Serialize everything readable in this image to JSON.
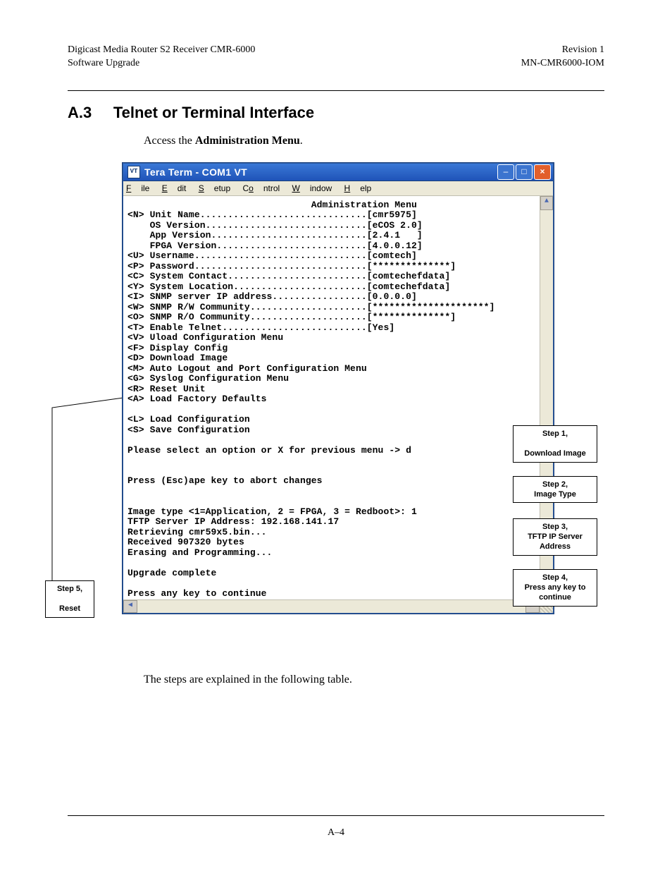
{
  "header": {
    "left1": "Digicast Media Router S2 Receiver CMR-6000",
    "left2": "Software Upgrade",
    "right1": "Revision 1",
    "right2": "MN-CMR6000-IOM"
  },
  "section": {
    "number": "A.3",
    "title": "Telnet or Terminal Interface"
  },
  "intro": {
    "prefix": "Access the ",
    "bold": "Administration Menu",
    "suffix": "."
  },
  "terminal": {
    "window_title": "Tera Term - COM1 VT",
    "menu": {
      "file": "File",
      "edit": "Edit",
      "setup": "Setup",
      "control": "Control",
      "window": "Window",
      "help": "Help"
    },
    "content": "                                 Administration Menu\n<N> Unit Name..............................[cmr5975]\n    OS Version.............................[eCOS 2.0]\n    App Version............................[2.4.1   ]\n    FPGA Version...........................[4.0.0.12]\n<U> Username...............................[comtech]\n<P> Password...............................[**************]\n<C> System Contact.........................[comtechefdata]\n<Y> System Location........................[comtechefdata]\n<I> SNMP server IP address.................[0.0.0.0]\n<W> SNMP R/W Community.....................[*********************]\n<O> SNMP R/O Community.....................[**************]\n<T> Enable Telnet..........................[Yes]\n<V> Uload Configuration Menu\n<F> Display Config\n<D> Download Image\n<M> Auto Logout and Port Configuration Menu\n<G> Syslog Configuration Menu\n<R> Reset Unit\n<A> Load Factory Defaults\n\n<L> Load Configuration\n<S> Save Configuration\n\nPlease select an option or X for previous menu -> d\n\n\nPress (Esc)ape key to abort changes\n\n\nImage type <1=Application, 2 = FPGA, 3 = Redboot>: 1\nTFTP Server IP Address: 192.168.141.17\nRetrieving cmr59x5.bin...\nReceived 907320 bytes\nErasing and Programming...\n\nUpgrade complete\n\nPress any key to continue"
  },
  "callouts": {
    "step1": "Step 1,\n<D>\nDownload Image",
    "step2": "Step 2,\nImage Type",
    "step3": "Step 3,\nTFTP IP Server\nAddress",
    "step4": "Step 4,\nPress any key to\ncontinue",
    "step5": "Step 5,\n<R>\nReset"
  },
  "follow_text": "The steps are explained in the following table.",
  "page_number": "A–4"
}
